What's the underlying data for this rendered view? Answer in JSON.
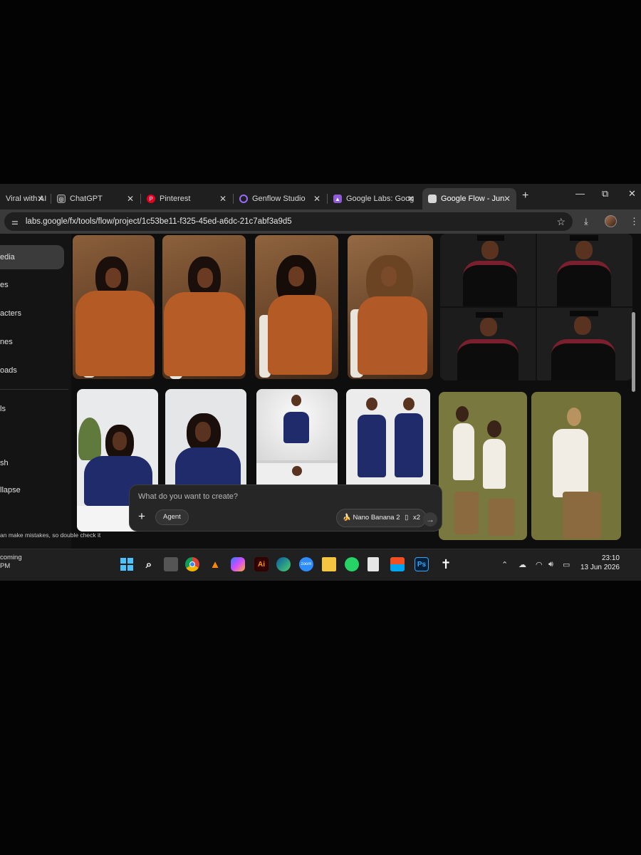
{
  "browser": {
    "tabs": [
      {
        "title": "Viral with AI",
        "icon": "orange-app-icon",
        "active": false
      },
      {
        "title": "ChatGPT",
        "icon": "chatgpt-icon",
        "active": false
      },
      {
        "title": "Pinterest",
        "icon": "pinterest-icon",
        "active": false
      },
      {
        "title": "Genflow Studio",
        "icon": "genflow-icon",
        "active": false
      },
      {
        "title": "Google Labs: Goog",
        "icon": "google-labs-icon",
        "active": false
      },
      {
        "title": "Google Flow - Jun",
        "icon": "flow-page-icon",
        "active": true
      }
    ],
    "new_tab": "+",
    "window_controls": {
      "minimize": "—",
      "restore": "⧉",
      "close": "✕"
    },
    "url": "labs.google/fx/tools/flow/project/1c53be11-f325-45ed-a6dc-21c7abf3a9d5"
  },
  "sidebar": {
    "items": [
      {
        "label": "edia",
        "active": true
      },
      {
        "label": "es",
        "active": false
      },
      {
        "label": "acters",
        "active": false
      },
      {
        "label": "nes",
        "active": false
      },
      {
        "label": "oads",
        "active": false
      },
      {
        "label": "ls",
        "active": false
      },
      {
        "label": "sh",
        "active": false
      },
      {
        "label": "llapse",
        "active": false
      }
    ],
    "disclaimer": "an make mistakes, so double check it"
  },
  "gallery": {
    "colors": {
      "orange_dress": "#b45a25",
      "brown_backdrop": "#6d4a2e",
      "navy_suit": "#1f2b6b",
      "white_backdrop": "#e9eaec",
      "olive_backdrop": "#79793f",
      "graduation_backdrop": "#1c1c1c",
      "maroon_hood": "#7a1f2e"
    },
    "items": [
      {
        "name": "orange-dress-portrait-1"
      },
      {
        "name": "orange-dress-portrait-2"
      },
      {
        "name": "orange-dress-portrait-3"
      },
      {
        "name": "orange-dress-portrait-4"
      },
      {
        "name": "graduation-portrait-grid"
      },
      {
        "name": "navy-suit-portrait-1"
      },
      {
        "name": "navy-suit-portrait-2"
      },
      {
        "name": "navy-dress-portrait-1"
      },
      {
        "name": "navy-dress-portrait-2"
      },
      {
        "name": "olive-white-dress-portrait-1"
      },
      {
        "name": "olive-white-dress-portrait-2"
      }
    ]
  },
  "composer": {
    "placeholder": "What do you want to create?",
    "plus": "+",
    "agent_label": "Agent",
    "model_label": "Nano Banana 2",
    "count_label": "x2",
    "send": "→"
  },
  "taskbar": {
    "weather_line1": "coming",
    "weather_line2": "PM",
    "apps": [
      {
        "name": "start-icon",
        "label": ""
      },
      {
        "name": "search-icon",
        "label": ""
      },
      {
        "name": "task-view-icon",
        "label": ""
      },
      {
        "name": "chrome-icon",
        "label": ""
      },
      {
        "name": "vlc-icon",
        "label": ""
      },
      {
        "name": "copilot-icon",
        "label": ""
      },
      {
        "name": "illustrator-icon",
        "label": "Ai"
      },
      {
        "name": "edge-icon",
        "label": ""
      },
      {
        "name": "zoom-icon",
        "label": "zoom"
      },
      {
        "name": "file-explorer-icon",
        "label": ""
      },
      {
        "name": "whatsapp-icon",
        "label": ""
      },
      {
        "name": "notepad-icon",
        "label": ""
      },
      {
        "name": "store-icon",
        "label": ""
      },
      {
        "name": "photoshop-icon",
        "label": "Ps"
      },
      {
        "name": "cross-icon",
        "label": "✝"
      }
    ],
    "time": "23:10",
    "date": "13 Jun 2026"
  }
}
